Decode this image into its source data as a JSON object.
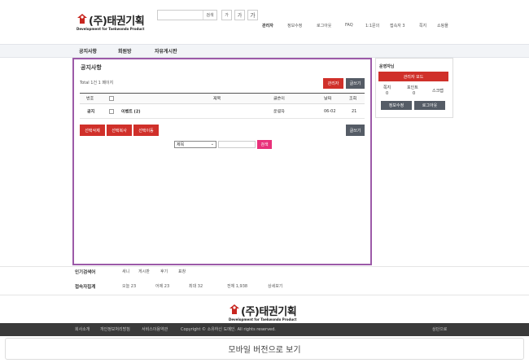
{
  "header": {
    "logo_text": "(주)태권기획",
    "logo_sub": "Development for Taekwondo Product",
    "search_button": "검색",
    "search_placeholder": "",
    "font_sizes": [
      "가",
      "가",
      "가"
    ],
    "nav": [
      "관리자",
      "정보수정",
      "로그아웃",
      "FAQ",
      "1:1문의",
      "접속자 3",
      "쪽지",
      "쇼핑몰"
    ]
  },
  "menu": [
    "공지사항",
    "회원방",
    "자유게시판"
  ],
  "board": {
    "title": "공지사항",
    "total": "Total 1건 1 페이지",
    "admin_button": "관리자",
    "write_button": "글쓰기",
    "columns": [
      "번호",
      "제목",
      "글쓴이",
      "날짜",
      "조회"
    ],
    "rows": [
      {
        "num": "공지",
        "subject": "이벤트 (2)",
        "author": "운영자",
        "date": "06-02",
        "views": "21"
      }
    ],
    "bulk_buttons": [
      "선택삭제",
      "선택복사",
      "선택이동"
    ],
    "write_button_bottom": "글쓰기",
    "search_select": "제목",
    "search_button": "검색"
  },
  "sidebar": {
    "title": "운영자님",
    "admin_mode": "관리자 모드",
    "stats": [
      {
        "label": "쪽지",
        "value": "0"
      },
      {
        "label": "포인트",
        "value": "0"
      },
      {
        "label": "스크랩",
        "value": ""
      }
    ],
    "edit_button": "정보수정",
    "logout_button": "로그아웃"
  },
  "popular": {
    "title": "인기검색어",
    "items": [
      "새니",
      "게시판",
      "후기",
      "표창"
    ]
  },
  "visitors": {
    "title": "접속자집계",
    "items": [
      "오늘 23",
      "어제 23",
      "최대 32",
      "전체 1,938"
    ],
    "detail": "상세보기"
  },
  "footer": {
    "links": [
      "회사소개",
      "개인정보처리방침",
      "서비스이용약관"
    ],
    "copyright": "Copyright © 소유하신 도메인. All rights reserved.",
    "top_link": "상단으로",
    "mobile": "모바일 버전으로 보기"
  },
  "colors": {
    "accent": "#d0302a",
    "frame": "#9c5aa8",
    "dark": "#555c66"
  }
}
